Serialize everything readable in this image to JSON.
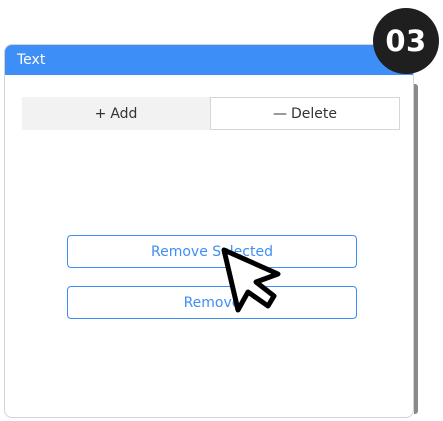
{
  "panel": {
    "title": "Text"
  },
  "tabs": [
    {
      "icon": "plus-icon",
      "symbol": "+",
      "label": "Add"
    },
    {
      "icon": "minus-icon",
      "symbol": "—",
      "label": "Delete"
    }
  ],
  "buttons": {
    "remove_selected": "Remove Selected",
    "remove": "Remove"
  },
  "step_badge": "03",
  "colors": {
    "accent": "#3d8ef7",
    "badge_bg": "#1f1f1f"
  }
}
